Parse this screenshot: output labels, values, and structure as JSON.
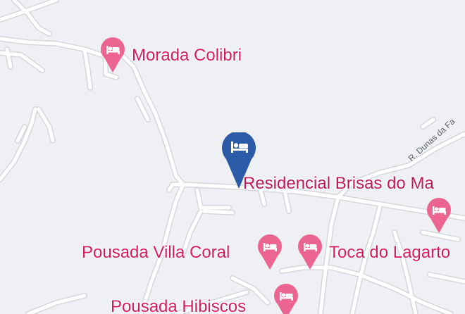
{
  "map": {
    "street_label": "R. Dunas da Fa",
    "places": [
      {
        "name": "Morada Colibri",
        "icon": "hotel-bed-icon",
        "pin_color": "#ec6490",
        "selected": false
      },
      {
        "name": "Residencial Brisas do Ma",
        "icon": "hotel-bed-icon",
        "pin_color": "#2b5aa6",
        "selected": true
      },
      {
        "name": "Pousada Villa Coral",
        "icon": "hotel-bed-icon",
        "pin_color": "#ec6490",
        "selected": false
      },
      {
        "name": "Toca do Lagarto",
        "icon": "hotel-bed-icon",
        "pin_color": "#ec6490",
        "selected": false
      },
      {
        "name": "Pousada Hibiscos",
        "icon": "hotel-bed-icon",
        "pin_color": "#ec6490",
        "selected": false
      },
      {
        "name": "",
        "icon": "hotel-bed-icon",
        "pin_color": "#ec6490",
        "selected": false
      }
    ],
    "colors": {
      "background": "#eef0f3",
      "road": "#ffffff",
      "road_casing": "#d4d7dc",
      "label": "#d81b60"
    }
  }
}
